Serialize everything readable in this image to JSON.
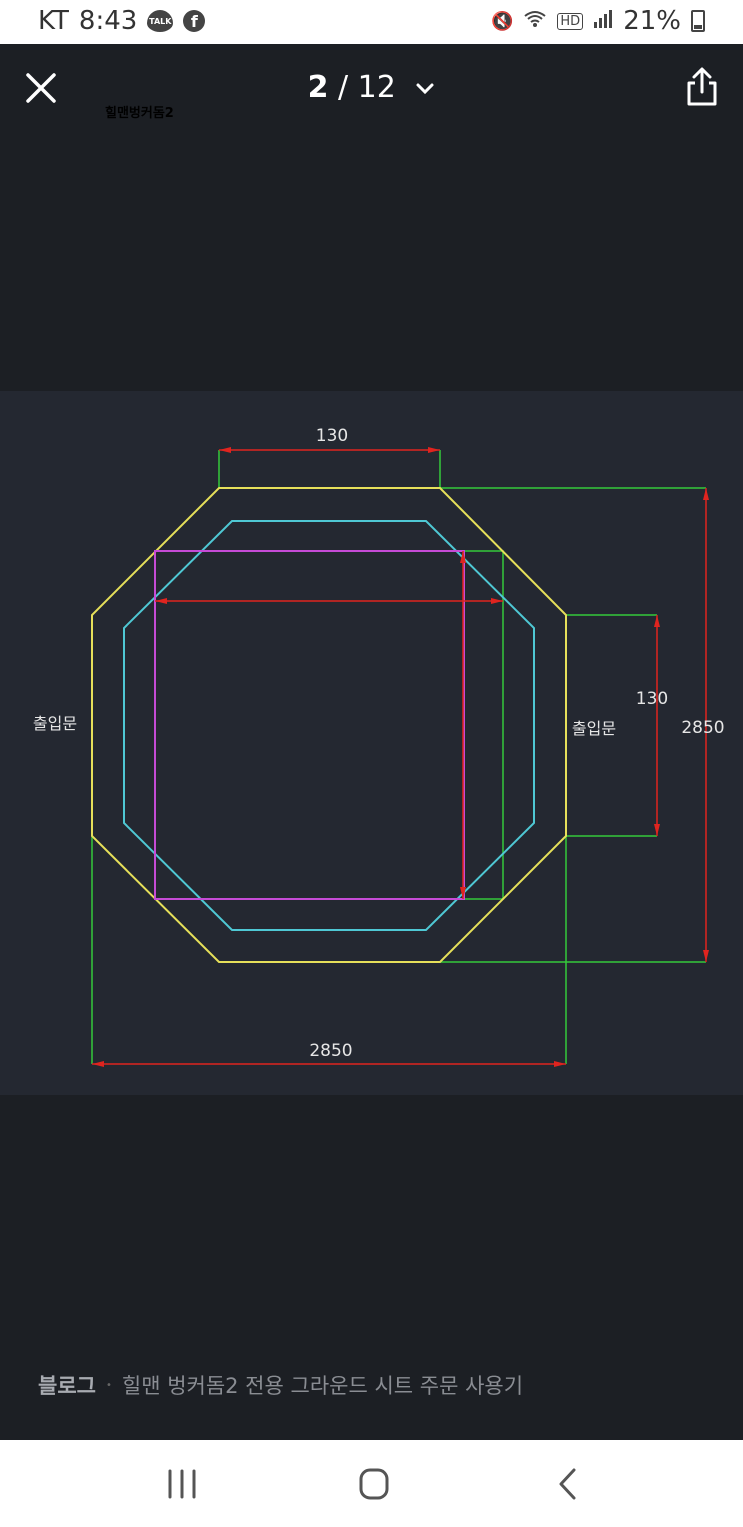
{
  "status_bar": {
    "carrier": "KT",
    "time": "8:43",
    "talk_badge": "TALK",
    "facebook_glyph": "f",
    "battery": "21%"
  },
  "viewer": {
    "title": "힐맨벙커돔2",
    "current_page": "2",
    "separator": " / ",
    "total_pages": "12"
  },
  "drawing": {
    "top_dim": "130",
    "right_inner_dim": "130",
    "right_dim": "2850",
    "bottom_dim": "2850",
    "door_left": "출입문",
    "door_right": "출입문",
    "colors": {
      "outer": "#e6e05a",
      "inner": "#4fc8d4",
      "square": "#c64bd6",
      "dimension": "#e0241f",
      "extension": "#35c93a",
      "text": "#e6e6e6"
    }
  },
  "caption": {
    "source": "블로그",
    "separator": "•",
    "text": "힐맨 벙커돔2 전용 그라운드 시트 주문 사용기"
  }
}
